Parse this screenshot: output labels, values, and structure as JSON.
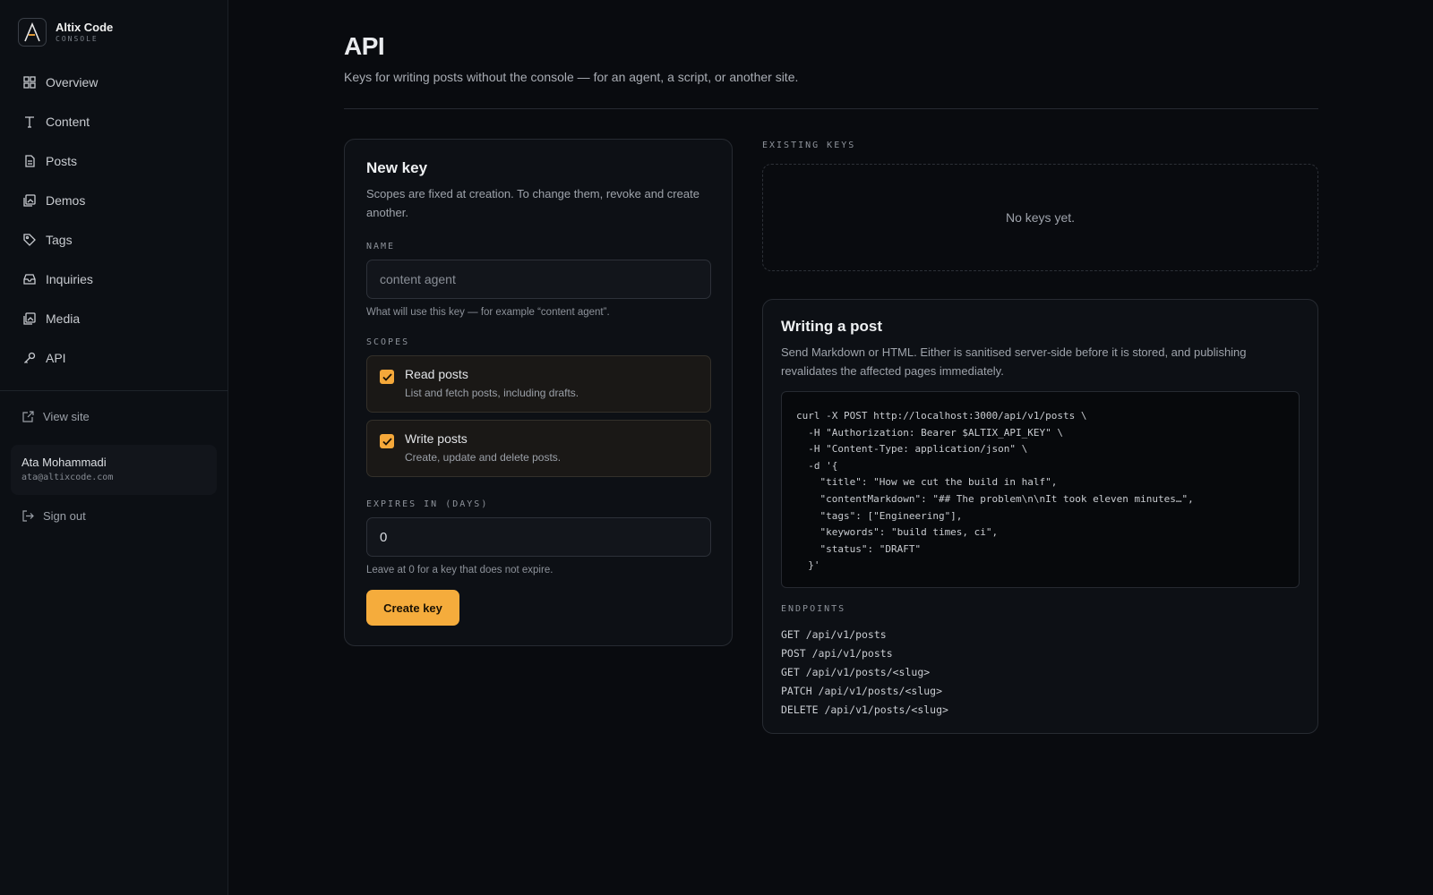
{
  "brand": {
    "name": "Altix Code",
    "subtitle": "CONSOLE",
    "logo_icon": "a-logo-icon",
    "logo_accent": "#f5a83a"
  },
  "sidebar": {
    "items": [
      {
        "label": "Overview",
        "icon": "grid-icon"
      },
      {
        "label": "Content",
        "icon": "text-icon"
      },
      {
        "label": "Posts",
        "icon": "document-icon"
      },
      {
        "label": "Demos",
        "icon": "gallery-icon"
      },
      {
        "label": "Tags",
        "icon": "tag-icon"
      },
      {
        "label": "Inquiries",
        "icon": "inbox-icon"
      },
      {
        "label": "Media",
        "icon": "image-icon"
      },
      {
        "label": "API",
        "icon": "key-icon"
      }
    ],
    "view_site": "View site",
    "user": {
      "name": "Ata Mohammadi",
      "email": "ata@altixcode.com"
    },
    "sign_out": "Sign out"
  },
  "page": {
    "title": "API",
    "subtitle": "Keys for writing posts without the console — for an agent, a script, or another site."
  },
  "new_key": {
    "title": "New key",
    "description": "Scopes are fixed at creation. To change them, revoke and create another.",
    "name_label": "NAME",
    "name_placeholder": "content agent",
    "name_hint": "What will use this key — for example “content agent”.",
    "scopes_label": "SCOPES",
    "scopes": [
      {
        "title": "Read posts",
        "description": "List and fetch posts, including drafts.",
        "checked": true
      },
      {
        "title": "Write posts",
        "description": "Create, update and delete posts.",
        "checked": true
      }
    ],
    "expires_label": "EXPIRES IN (DAYS)",
    "expires_value": "0",
    "expires_hint": "Leave at 0 for a key that does not expire.",
    "create_button": "Create key"
  },
  "existing_keys": {
    "label": "EXISTING KEYS",
    "empty_text": "No keys yet."
  },
  "writing_post": {
    "title": "Writing a post",
    "description": "Send Markdown or HTML. Either is sanitised server-side before it is stored, and publishing revalidates the affected pages immediately.",
    "code": "curl -X POST http://localhost:3000/api/v1/posts \\\n  -H \"Authorization: Bearer $ALTIX_API_KEY\" \\\n  -H \"Content-Type: application/json\" \\\n  -d '{\n    \"title\": \"How we cut the build in half\",\n    \"contentMarkdown\": \"## The problem\\n\\nIt took eleven minutes…\",\n    \"tags\": [\"Engineering\"],\n    \"keywords\": \"build times, ci\",\n    \"status\": \"DRAFT\"\n  }'",
    "endpoints_label": "ENDPOINTS",
    "endpoints": [
      "GET /api/v1/posts",
      "POST /api/v1/posts",
      "GET /api/v1/posts/<slug>",
      "PATCH /api/v1/posts/<slug>",
      "DELETE /api/v1/posts/<slug>"
    ]
  },
  "colors": {
    "accent": "#f5ac3c",
    "background": "#090b0f",
    "sidebar": "#0c0f14"
  }
}
